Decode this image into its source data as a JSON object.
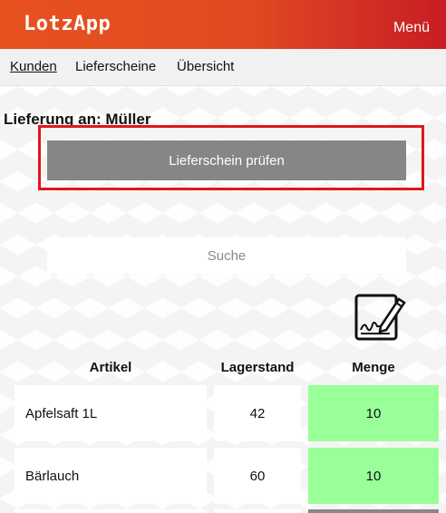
{
  "app": {
    "title": "LotzApp",
    "menu_label": "Menü"
  },
  "nav": {
    "items": [
      {
        "label": "Kunden",
        "active": true
      },
      {
        "label": "Lieferscheine",
        "active": false
      },
      {
        "label": "Übersicht",
        "active": false
      }
    ]
  },
  "delivery": {
    "title": "Lieferung an: Müller",
    "check_button": "Lieferschein prüfen"
  },
  "search": {
    "placeholder": "Suche"
  },
  "icons": {
    "sign": "sign-document-icon"
  },
  "colors": {
    "brand_start": "#e8521f",
    "brand_end": "#c81d25",
    "qty_bg": "#99ff99",
    "highlight": "#e3151c"
  },
  "table": {
    "headers": {
      "article": "Artikel",
      "stock": "Lagerstand",
      "quantity": "Menge"
    },
    "rows": [
      {
        "article": "Apfelsaft 1L",
        "stock": "42",
        "quantity": "10"
      },
      {
        "article": "Bärlauch",
        "stock": "60",
        "quantity": "10"
      }
    ]
  }
}
